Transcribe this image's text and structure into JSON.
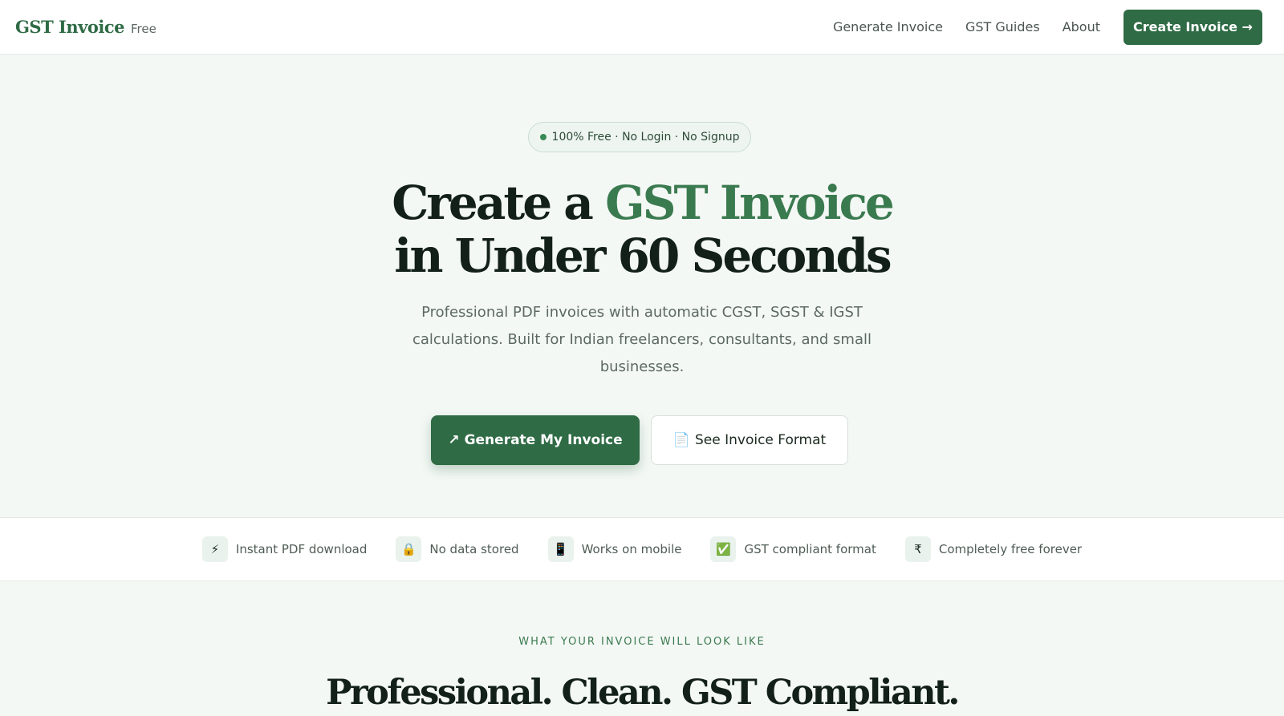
{
  "nav": {
    "brand_name": "GST Invoice",
    "brand_tag": "Free",
    "links": [
      "Generate Invoice",
      "GST Guides",
      "About"
    ],
    "cta_label": "Create Invoice →"
  },
  "hero": {
    "pill_text": "100% Free · No Login · No Signup",
    "title_line1_prefix": "Create a ",
    "title_line1_accent": "GST Invoice",
    "title_line2": "in Under 60 Seconds",
    "subtitle": "Professional PDF invoices with automatic CGST, SGST & IGST calculations. Built for Indian freelancers, consultants, and small businesses.",
    "primary_button": {
      "icon": "↗",
      "label": "Generate My Invoice"
    },
    "secondary_button": {
      "icon": "📄",
      "label": "See Invoice Format"
    }
  },
  "features": [
    {
      "icon": "⚡",
      "icon_name": "lightning-icon",
      "label": "Instant PDF download"
    },
    {
      "icon": "🔒",
      "icon_name": "lock-icon",
      "label": "No data stored"
    },
    {
      "icon": "📱",
      "icon_name": "mobile-icon",
      "label": "Works on mobile"
    },
    {
      "icon": "✅",
      "icon_name": "check-icon",
      "label": "GST compliant format"
    },
    {
      "icon": "₹",
      "icon_name": "rupee-icon",
      "label": "Completely free forever"
    }
  ],
  "preview": {
    "eyebrow": "WHAT YOUR INVOICE WILL LOOK LIKE",
    "title": "Professional. Clean. GST Compliant."
  },
  "colors": {
    "brand": "#2f6b45",
    "accent": "#3a7a4f",
    "background": "#f4f8f5"
  }
}
